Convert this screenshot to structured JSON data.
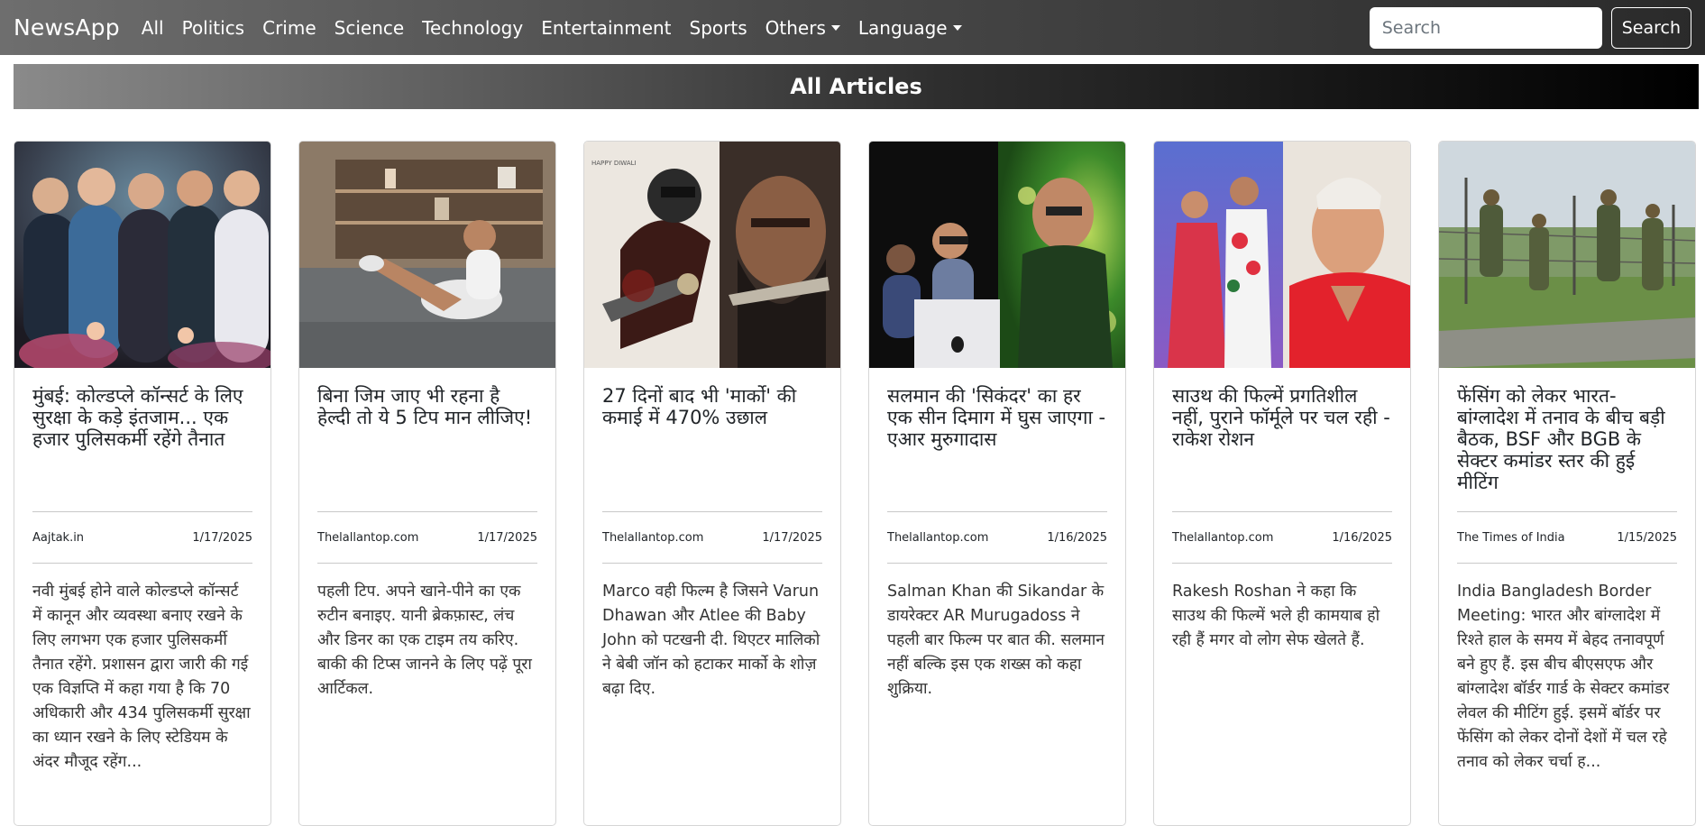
{
  "navbar": {
    "brand": "NewsApp",
    "links": [
      "All",
      "Politics",
      "Crime",
      "Science",
      "Technology",
      "Entertainment",
      "Sports"
    ],
    "others": "Others",
    "language": "Language",
    "search_placeholder": "Search",
    "search_button": "Search"
  },
  "header": {
    "title": "All Articles"
  },
  "articles": [
    {
      "title": "मुंबई: कोल्डप्ले कॉन्सर्ट के लिए सुरक्षा के कड़े इंतजाम... एक हजार पुलिसकर्मी रहेंगे तैनात",
      "source": "Aajtak.in",
      "date": "1/17/2025",
      "description": "नवी मुंबई होने वाले कोल्डप्ले कॉन्सर्ट में कानून और व्यवस्था बनाए रखने के लिए लगभग एक हजार पुलिसकर्मी तैनात रहेंगे. प्रशासन द्वारा जारी की गई एक विज्ञप्ति में कहा गया है कि 70 अधिकारी और 434 पुलिसकर्मी सुरक्षा का ध्यान रखने के लिए स्टेडियम के अंदर मौजूद रहेंग...",
      "image": "band-photo"
    },
    {
      "title": "बिना जिम जाए भी रहना है हेल्दी तो ये 5 टिप मान लीजिए!",
      "source": "Thelallantop.com",
      "date": "1/17/2025",
      "description": "पहली टिप. अपने खाने-पीने का एक रुटीन बनाइए. यानी ब्रेकफ़ास्ट, लंच और डिनर का एक टाइम तय करिए. बाकी की टिप्स जानने के लिए पढ़ें पूरा आर्टिकल.",
      "image": "workout-photo"
    },
    {
      "title": "27 दिनों बाद भी 'मार्को' की कमाई में 470% उछाल",
      "source": "Thelallantop.com",
      "date": "1/17/2025",
      "description": "Marco वही फिल्म है जिसने Varun Dhawan और Atlee की Baby John को पटखनी दी. थिएटर मालिको ने बेबी जॉन को हटाकर मार्को के शोज़ बढ़ा दिए.",
      "image": "movie-poster",
      "poster_text": "HAPPY DIWALI"
    },
    {
      "title": "सलमान की 'सिकंदर' का हर एक सीन दिमाग में घुस जाएगा - एआर मुरुगादास",
      "source": "Thelallantop.com",
      "date": "1/16/2025",
      "description": "Salman Khan की Sikandar के डायरेक्टर AR Murugadoss ने पहली बार फिल्म पर बात की. सलमान नहीं बल्कि इस एक शख्स को कहा शुक्रिया.",
      "image": "salman-photo"
    },
    {
      "title": "साउथ की फिल्में प्रगतिशील नहीं, पुराने फॉर्मूले पर चल रही - राकेश रोशन",
      "source": "Thelallantop.com",
      "date": "1/16/2025",
      "description": "Rakesh Roshan ने कहा कि साउथ की फिल्में भले ही कामयाब हो रही हैं मगर वो लोग सेफ खेलते हैं.",
      "image": "rakesh-photo"
    },
    {
      "title": "फेंसिंग को लेकर भारत-बांग्लादेश में तनाव के बीच बड़ी बैठक, BSF और BGB के सेक्टर कमांडर स्तर की हुई मीटिंग",
      "source": "The Times of India",
      "date": "1/15/2025",
      "description": "India Bangladesh Border Meeting: भारत और बांग्लादेश में रिश्ते हाल के समय में बेहद तनावपूर्ण बने हुए हैं. इस बीच बीएसएफ और बांग्लादेश बॉर्डर गार्ड के सेक्टर कमांडर लेवल की मीटिंग हुई. इसमें बॉर्डर पर फेंसिंग को लेकर दोनों देशों में चल रहे तनाव को लेकर चर्चा ह...",
      "image": "border-photo"
    }
  ]
}
